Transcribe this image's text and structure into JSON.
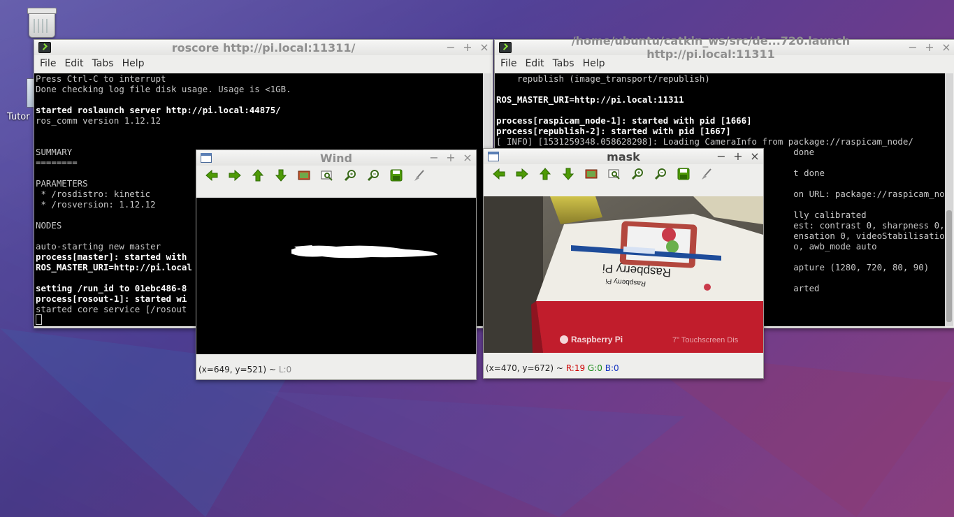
{
  "desktop": {
    "icons": [
      {
        "label": "Tutor",
        "icon": "document-icon"
      }
    ]
  },
  "term_left": {
    "title": "roscore http://pi.local:11311/",
    "menu": [
      "File",
      "Edit",
      "Tabs",
      "Help"
    ],
    "lines": [
      {
        "t": "Press Ctrl-C to interrupt",
        "b": false
      },
      {
        "t": "Done checking log file disk usage. Usage is <1GB.",
        "b": false
      },
      {
        "t": "",
        "b": false
      },
      {
        "t": "started roslaunch server http://pi.local:44875/",
        "b": true
      },
      {
        "t": "ros_comm version 1.12.12",
        "b": false
      },
      {
        "t": "",
        "b": false
      },
      {
        "t": "",
        "b": false
      },
      {
        "t": "SUMMARY",
        "b": false
      },
      {
        "t": "========",
        "b": false
      },
      {
        "t": "",
        "b": false
      },
      {
        "t": "PARAMETERS",
        "b": false
      },
      {
        "t": " * /rosdistro: kinetic",
        "b": false
      },
      {
        "t": " * /rosversion: 1.12.12",
        "b": false
      },
      {
        "t": "",
        "b": false
      },
      {
        "t": "NODES",
        "b": false
      },
      {
        "t": "",
        "b": false
      },
      {
        "t": "auto-starting new master",
        "b": false
      },
      {
        "t": "process[master]: started with",
        "b": true
      },
      {
        "t": "ROS_MASTER_URI=http://pi.local",
        "b": true
      },
      {
        "t": "",
        "b": false
      },
      {
        "t": "setting /run_id to 01ebc486-8",
        "b": true
      },
      {
        "t": "process[rosout-1]: started wi",
        "b": true
      },
      {
        "t": "started core service [/rosout",
        "b": false
      }
    ]
  },
  "term_right": {
    "title": "/home/ubuntu/catkin_ws/src/de...720.launch http://pi.local:11311",
    "menu": [
      "File",
      "Edit",
      "Tabs",
      "Help"
    ],
    "lines": [
      {
        "t": "    republish (image_transport/republish)",
        "b": false
      },
      {
        "t": "",
        "b": false
      },
      {
        "t": "ROS_MASTER_URI=http://pi.local:11311",
        "b": true
      },
      {
        "t": "",
        "b": false
      },
      {
        "t": "process[raspicam_node-1]: started with pid [1666]",
        "b": true
      },
      {
        "t": "process[republish-2]: started with pid [1667]",
        "b": true
      },
      {
        "t": "[ INFO] [1531259348.058628298]: Loading CameraInfo from package://raspicam_node/",
        "b": false
      },
      {
        "t": "                                                         done",
        "b": false
      },
      {
        "t": "",
        "b": false
      },
      {
        "t": "                                                         t done",
        "b": false
      },
      {
        "t": "",
        "b": false
      },
      {
        "t": "                                                         on URL: package://raspicam_node/",
        "b": false
      },
      {
        "t": "",
        "b": false
      },
      {
        "t": "                                                         lly calibrated",
        "b": false
      },
      {
        "t": "                                                         est: contrast 0, sharpness 0, br",
        "b": false
      },
      {
        "t": "                                                         ensation 0, videoStabilisation 0",
        "b": false
      },
      {
        "t": "                                                         o, awb_mode auto",
        "b": false
      },
      {
        "t": "",
        "b": false
      },
      {
        "t": "                                                         apture (1280, 720, 80, 90)",
        "b": false
      },
      {
        "t": "",
        "b": false
      },
      {
        "t": "                                                         arted",
        "b": false
      }
    ]
  },
  "wind": {
    "title": "Wind",
    "status_coords": "(x=649, y=521) ~",
    "status_level": "L:0"
  },
  "mask": {
    "title": "mask",
    "status_coords": "(x=470, y=672) ~",
    "status_r": "R:19",
    "status_g": "G:0",
    "status_b": "B:0",
    "box_text_1": "Raspberry Pi",
    "box_text_2": "Raspberry Pi",
    "box_text_3": "Raspberry Pi",
    "box_text_4": "7\" Touchscreen Dis"
  },
  "window_controls": {
    "minimize": "−",
    "maximize": "+",
    "close": "×"
  },
  "toolbar_icons": [
    "back-arrow-icon",
    "forward-arrow-icon",
    "up-arrow-icon",
    "down-arrow-icon",
    "image-icon",
    "zoom-fit-icon",
    "zoom-in-icon",
    "zoom-out-icon",
    "save-icon",
    "brush-icon"
  ],
  "colors": {
    "arrow": "#4e9a06",
    "accent_red": "#cc0000",
    "accent_green": "#1a8a1a",
    "accent_blue": "#1030c0"
  }
}
